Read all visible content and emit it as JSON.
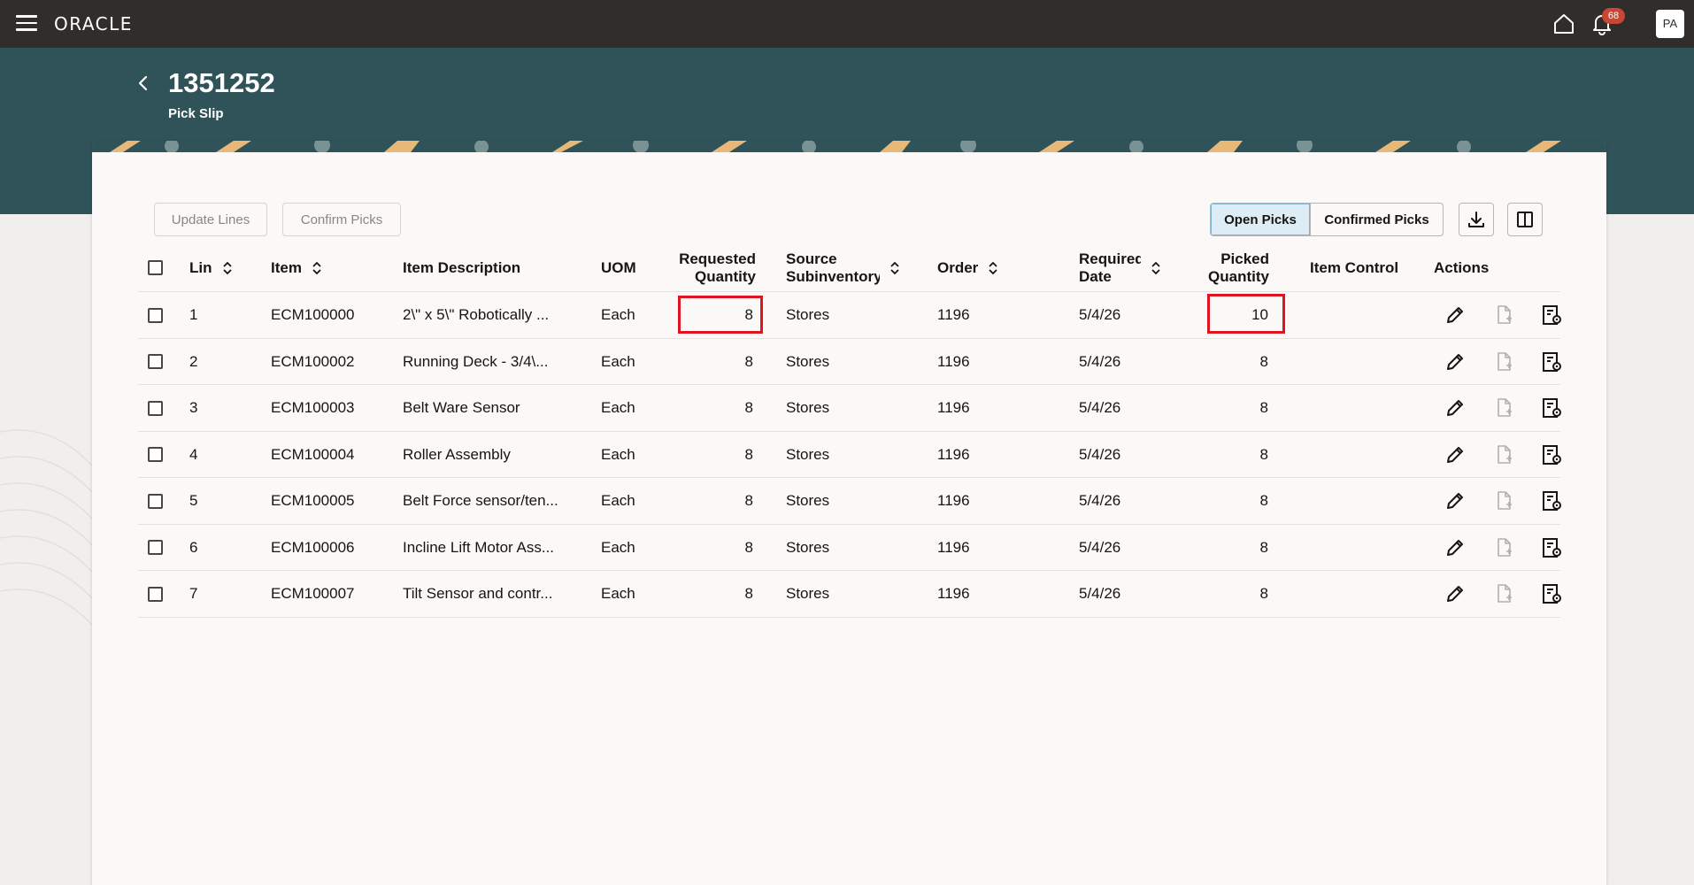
{
  "header": {
    "brand": "ORACLE",
    "notification_count": "68",
    "avatar_initials": "PA"
  },
  "page": {
    "title": "1351252",
    "subtitle": "Pick Slip"
  },
  "toolbar": {
    "update_lines_label": "Update Lines",
    "confirm_picks_label": "Confirm Picks",
    "open_picks_label": "Open Picks",
    "confirmed_picks_label": "Confirmed Picks"
  },
  "table": {
    "columns": {
      "line": "Lin",
      "item": "Item",
      "description": "Item Description",
      "uom": "UOM",
      "requested_1": "Requested",
      "requested_2": "Quantity",
      "source_1": "Source",
      "source_2": "Subinventory",
      "order": "Order",
      "required_1": "Required",
      "required_2": "Date",
      "picked_1": "Picked",
      "picked_2": "Quantity",
      "item_control": "Item Control",
      "actions": "Actions"
    },
    "rows": [
      {
        "line": "1",
        "item": "ECM100000",
        "description": "2\\\" x 5\\\" Robotically ...",
        "uom": "Each",
        "requested": "8",
        "source": "Stores",
        "order": "1196",
        "required": "5/4/26",
        "picked": "10"
      },
      {
        "line": "2",
        "item": "ECM100002",
        "description": "Running Deck  - 3/4\\...",
        "uom": "Each",
        "requested": "8",
        "source": "Stores",
        "order": "1196",
        "required": "5/4/26",
        "picked": "8"
      },
      {
        "line": "3",
        "item": "ECM100003",
        "description": "Belt Ware Sensor",
        "uom": "Each",
        "requested": "8",
        "source": "Stores",
        "order": "1196",
        "required": "5/4/26",
        "picked": "8"
      },
      {
        "line": "4",
        "item": "ECM100004",
        "description": "Roller Assembly",
        "uom": "Each",
        "requested": "8",
        "source": "Stores",
        "order": "1196",
        "required": "5/4/26",
        "picked": "8"
      },
      {
        "line": "5",
        "item": "ECM100005",
        "description": "Belt Force sensor/ten...",
        "uom": "Each",
        "requested": "8",
        "source": "Stores",
        "order": "1196",
        "required": "5/4/26",
        "picked": "8"
      },
      {
        "line": "6",
        "item": "ECM100006",
        "description": "Incline Lift Motor Ass...",
        "uom": "Each",
        "requested": "8",
        "source": "Stores",
        "order": "1196",
        "required": "5/4/26",
        "picked": "8"
      },
      {
        "line": "7",
        "item": "ECM100007",
        "description": "Tilt Sensor and contr...",
        "uom": "Each",
        "requested": "8",
        "source": "Stores",
        "order": "1196",
        "required": "5/4/26",
        "picked": "8"
      }
    ]
  },
  "colors": {
    "topbar": "#312d2a",
    "header_band": "#2f5359",
    "highlight": "#e0141e",
    "badge": "#c74634"
  }
}
